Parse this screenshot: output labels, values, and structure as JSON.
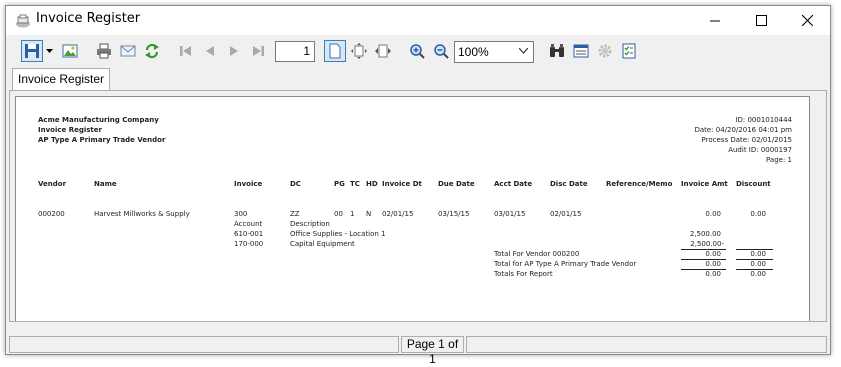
{
  "window": {
    "title": "Invoice Register"
  },
  "toolbar": {
    "page_number": "1",
    "zoom": "100%",
    "buttons": [
      "save-icon",
      "save-dropdown-icon",
      "export-image-icon",
      "print-icon",
      "email-icon",
      "refresh-icon",
      "first-page-icon",
      "prev-page-icon",
      "next-page-icon",
      "last-page-icon",
      "single-page-icon",
      "fit-page-icon",
      "fit-width-icon",
      "zoom-in-icon",
      "zoom-out-icon",
      "find-icon",
      "page-setup-icon",
      "settings-icon",
      "parameters-icon"
    ]
  },
  "tab": {
    "label": "Invoice Register"
  },
  "report": {
    "company": "Acme Manufacturing Company",
    "report_title": "Invoice Register",
    "subtitle": "AP Type A  Primary Trade Vendor",
    "meta": {
      "id": "ID: 0001010444",
      "date": "Date: 04/20/2016 04:01 pm",
      "process_date": "Process Date: 02/01/2015",
      "audit_id": "Audit ID: 0000197",
      "page": "Page: 1"
    },
    "columns": {
      "vendor": "Vendor",
      "name": "Name",
      "invoice": "Invoice",
      "dc": "DC",
      "pg": "PG",
      "tc": "TC",
      "hd": "HD",
      "invoice_dt": "Invoice Dt",
      "due_date": "Due Date",
      "acct_date": "Acct Date",
      "disc_date": "Disc Date",
      "reference": "Reference/Memo",
      "invoice_amt": "Invoice Amt",
      "discount": "Discount"
    },
    "row": {
      "vendor": "000200",
      "name": "Harvest Millworks & Supply",
      "invoice": "300",
      "dc": "ZZ",
      "pg": "00",
      "tc": "1",
      "hd": "N",
      "invoice_dt": "02/01/15",
      "due_date": "03/15/15",
      "acct_date": "03/01/15",
      "disc_date": "02/01/15",
      "invoice_amt": "0.00",
      "discount": "0.00"
    },
    "sub_headers": {
      "account": "Account",
      "description": "Description"
    },
    "lines": [
      {
        "account": "610-001",
        "description": "Office Supplies - Location 1",
        "amount": "2,500.00"
      },
      {
        "account": "170-000",
        "description": "Capital Equipment",
        "amount": "2,500.00-"
      }
    ],
    "totals": [
      {
        "label": "Total For Vendor 000200",
        "amount": "0.00",
        "discount": "0.00"
      },
      {
        "label": "Total for AP Type A  Primary Trade Vendor",
        "amount": "0.00",
        "discount": "0.00"
      },
      {
        "label": "Totals For Report",
        "amount": "0.00",
        "discount": "0.00"
      }
    ]
  },
  "status": {
    "page_text": "Page 1 of 1"
  }
}
